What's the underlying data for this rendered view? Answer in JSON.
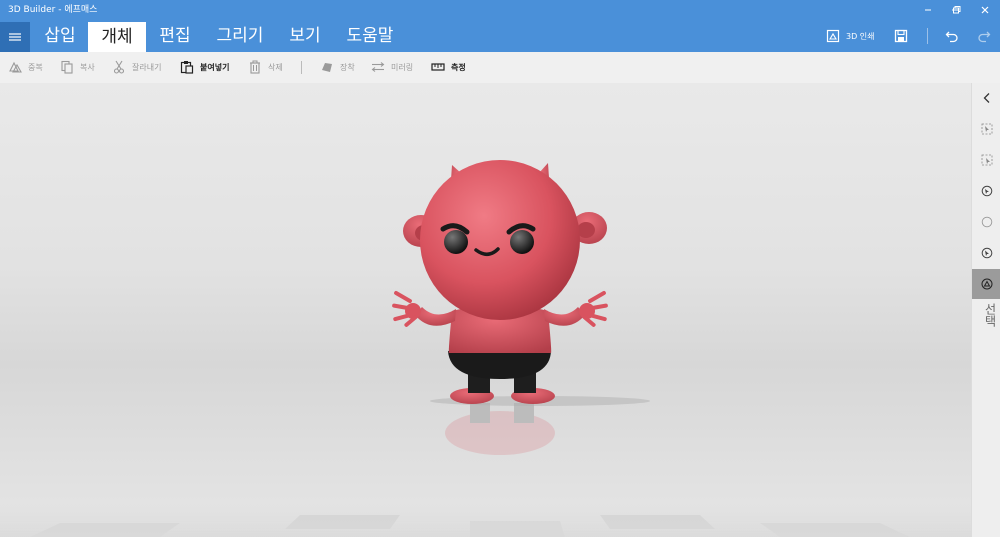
{
  "window": {
    "title": "3D Builder - 에프매스"
  },
  "ribbon": {
    "tabs": [
      {
        "label": "삽입"
      },
      {
        "label": "개체"
      },
      {
        "label": "편집"
      },
      {
        "label": "그리기"
      },
      {
        "label": "보기"
      },
      {
        "label": "도움말"
      }
    ],
    "active_tab": "개체",
    "print_label": "3D 인쇄"
  },
  "toolbar": {
    "duplicate": "중복",
    "copy": "복사",
    "cut": "잘라내기",
    "paste": "붙여넣기",
    "delete": "삭제",
    "settle": "장착",
    "mirror": "미러링",
    "measure": "측정"
  },
  "sidepanel": {
    "label": "선택"
  },
  "colors": {
    "accent": "#4a90d9",
    "model": "#d9535f",
    "shorts": "#1a1a1a"
  }
}
